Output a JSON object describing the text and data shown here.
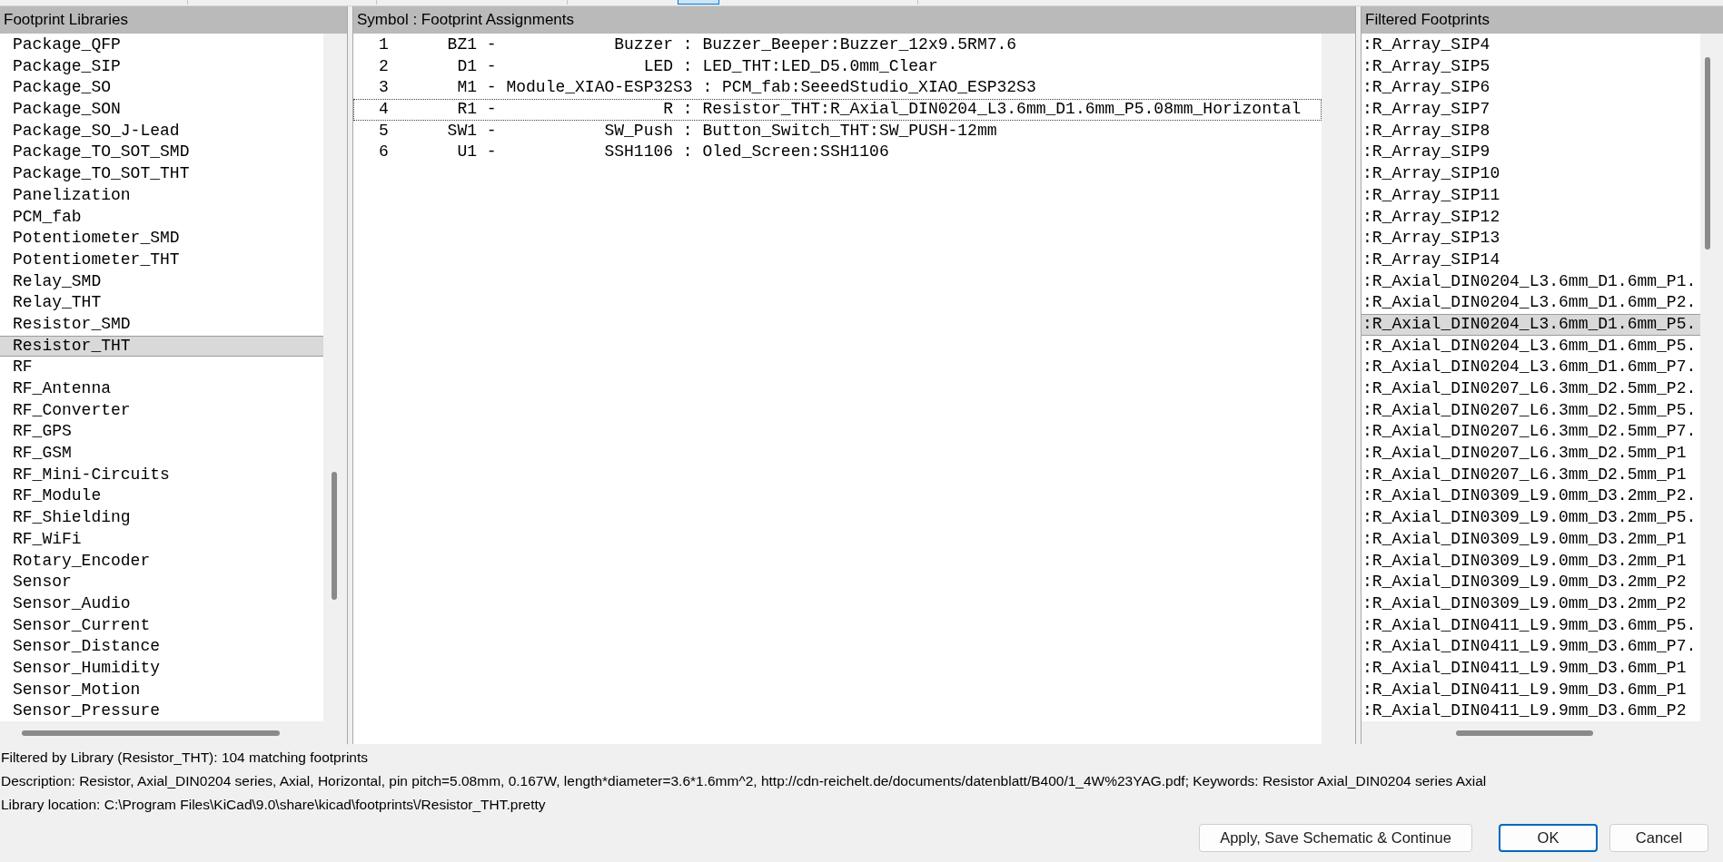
{
  "libraries_panel": {
    "title": "Footprint Libraries",
    "items": [
      {
        "label": "Package_QFP",
        "selected": false
      },
      {
        "label": "Package_SIP",
        "selected": false
      },
      {
        "label": "Package_SO",
        "selected": false
      },
      {
        "label": "Package_SON",
        "selected": false
      },
      {
        "label": "Package_SO_J-Lead",
        "selected": false
      },
      {
        "label": "Package_TO_SOT_SMD",
        "selected": false
      },
      {
        "label": "Package_TO_SOT_THT",
        "selected": false
      },
      {
        "label": "Panelization",
        "selected": false
      },
      {
        "label": "PCM_fab",
        "selected": false
      },
      {
        "label": "Potentiometer_SMD",
        "selected": false
      },
      {
        "label": "Potentiometer_THT",
        "selected": false
      },
      {
        "label": "Relay_SMD",
        "selected": false
      },
      {
        "label": "Relay_THT",
        "selected": false
      },
      {
        "label": "Resistor_SMD",
        "selected": false
      },
      {
        "label": "Resistor_THT",
        "selected": true
      },
      {
        "label": "RF",
        "selected": false
      },
      {
        "label": "RF_Antenna",
        "selected": false
      },
      {
        "label": "RF_Converter",
        "selected": false
      },
      {
        "label": "RF_GPS",
        "selected": false
      },
      {
        "label": "RF_GSM",
        "selected": false
      },
      {
        "label": "RF_Mini-Circuits",
        "selected": false
      },
      {
        "label": "RF_Module",
        "selected": false
      },
      {
        "label": "RF_Shielding",
        "selected": false
      },
      {
        "label": "RF_WiFi",
        "selected": false
      },
      {
        "label": "Rotary_Encoder",
        "selected": false
      },
      {
        "label": "Sensor",
        "selected": false
      },
      {
        "label": "Sensor_Audio",
        "selected": false
      },
      {
        "label": "Sensor_Current",
        "selected": false
      },
      {
        "label": "Sensor_Distance",
        "selected": false
      },
      {
        "label": "Sensor_Humidity",
        "selected": false
      },
      {
        "label": "Sensor_Motion",
        "selected": false
      },
      {
        "label": "Sensor_Pressure",
        "selected": false
      }
    ]
  },
  "assignments_panel": {
    "title": "Symbol : Footprint Assignments",
    "rows": [
      {
        "text": "1      BZ1 -            Buzzer : Buzzer_Beeper:Buzzer_12x9.5RM7.6",
        "focused": false
      },
      {
        "text": "2       D1 -               LED : LED_THT:LED_D5.0mm_Clear",
        "focused": false
      },
      {
        "text": "3       M1 - Module_XIAO-ESP32S3 : PCM_fab:SeeedStudio_XIAO_ESP32S3",
        "focused": false
      },
      {
        "text": "4       R1 -                 R : Resistor_THT:R_Axial_DIN0204_L3.6mm_D1.6mm_P5.08mm_Horizontal",
        "focused": true
      },
      {
        "text": "5      SW1 -           SW_Push : Button_Switch_THT:SW_PUSH-12mm",
        "focused": false
      },
      {
        "text": "6       U1 -           SSH1106 : Oled_Screen:SSH1106",
        "focused": false
      }
    ]
  },
  "footprints_panel": {
    "title": "Filtered Footprints",
    "items": [
      {
        "label": ":R_Array_SIP4",
        "selected": false
      },
      {
        "label": ":R_Array_SIP5",
        "selected": false
      },
      {
        "label": ":R_Array_SIP6",
        "selected": false
      },
      {
        "label": ":R_Array_SIP7",
        "selected": false
      },
      {
        "label": ":R_Array_SIP8",
        "selected": false
      },
      {
        "label": ":R_Array_SIP9",
        "selected": false
      },
      {
        "label": ":R_Array_SIP10",
        "selected": false
      },
      {
        "label": ":R_Array_SIP11",
        "selected": false
      },
      {
        "label": ":R_Array_SIP12",
        "selected": false
      },
      {
        "label": ":R_Array_SIP13",
        "selected": false
      },
      {
        "label": ":R_Array_SIP14",
        "selected": false
      },
      {
        "label": ":R_Axial_DIN0204_L3.6mm_D1.6mm_P1.",
        "selected": false
      },
      {
        "label": ":R_Axial_DIN0204_L3.6mm_D1.6mm_P2.",
        "selected": false
      },
      {
        "label": ":R_Axial_DIN0204_L3.6mm_D1.6mm_P5.",
        "selected": true
      },
      {
        "label": ":R_Axial_DIN0204_L3.6mm_D1.6mm_P5.",
        "selected": false
      },
      {
        "label": ":R_Axial_DIN0204_L3.6mm_D1.6mm_P7.",
        "selected": false
      },
      {
        "label": ":R_Axial_DIN0207_L6.3mm_D2.5mm_P2.",
        "selected": false
      },
      {
        "label": ":R_Axial_DIN0207_L6.3mm_D2.5mm_P5.",
        "selected": false
      },
      {
        "label": ":R_Axial_DIN0207_L6.3mm_D2.5mm_P7.",
        "selected": false
      },
      {
        "label": ":R_Axial_DIN0207_L6.3mm_D2.5mm_P1",
        "selected": false
      },
      {
        "label": ":R_Axial_DIN0207_L6.3mm_D2.5mm_P1",
        "selected": false
      },
      {
        "label": ":R_Axial_DIN0309_L9.0mm_D3.2mm_P2.",
        "selected": false
      },
      {
        "label": ":R_Axial_DIN0309_L9.0mm_D3.2mm_P5.",
        "selected": false
      },
      {
        "label": ":R_Axial_DIN0309_L9.0mm_D3.2mm_P1",
        "selected": false
      },
      {
        "label": ":R_Axial_DIN0309_L9.0mm_D3.2mm_P1",
        "selected": false
      },
      {
        "label": ":R_Axial_DIN0309_L9.0mm_D3.2mm_P2",
        "selected": false
      },
      {
        "label": ":R_Axial_DIN0309_L9.0mm_D3.2mm_P2",
        "selected": false
      },
      {
        "label": ":R_Axial_DIN0411_L9.9mm_D3.6mm_P5.",
        "selected": false
      },
      {
        "label": ":R_Axial_DIN0411_L9.9mm_D3.6mm_P7.",
        "selected": false
      },
      {
        "label": ":R_Axial_DIN0411_L9.9mm_D3.6mm_P1",
        "selected": false
      },
      {
        "label": ":R_Axial_DIN0411_L9.9mm_D3.6mm_P1",
        "selected": false
      },
      {
        "label": ":R_Axial_DIN0411_L9.9mm_D3.6mm_P2",
        "selected": false
      }
    ]
  },
  "status": {
    "filter": "Filtered by Library (Resistor_THT): 104 matching footprints",
    "description": "Description: Resistor, Axial_DIN0204 series, Axial, Horizontal, pin pitch=5.08mm, 0.167W, length*diameter=3.6*1.6mm^2, http://cdn-reichelt.de/documents/datenblatt/B400/1_4W%23YAG.pdf; Keywords: Resistor Axial_DIN0204 series Axial",
    "location": "Library location: C:\\Program Files\\KiCad\\9.0\\share\\kicad\\footprints\\/Resistor_THT.pretty"
  },
  "buttons": [
    {
      "label": "Apply, Save Schematic & Continue",
      "default": false
    },
    {
      "label": "OK",
      "default": true
    },
    {
      "label": "Cancel",
      "default": false
    }
  ]
}
